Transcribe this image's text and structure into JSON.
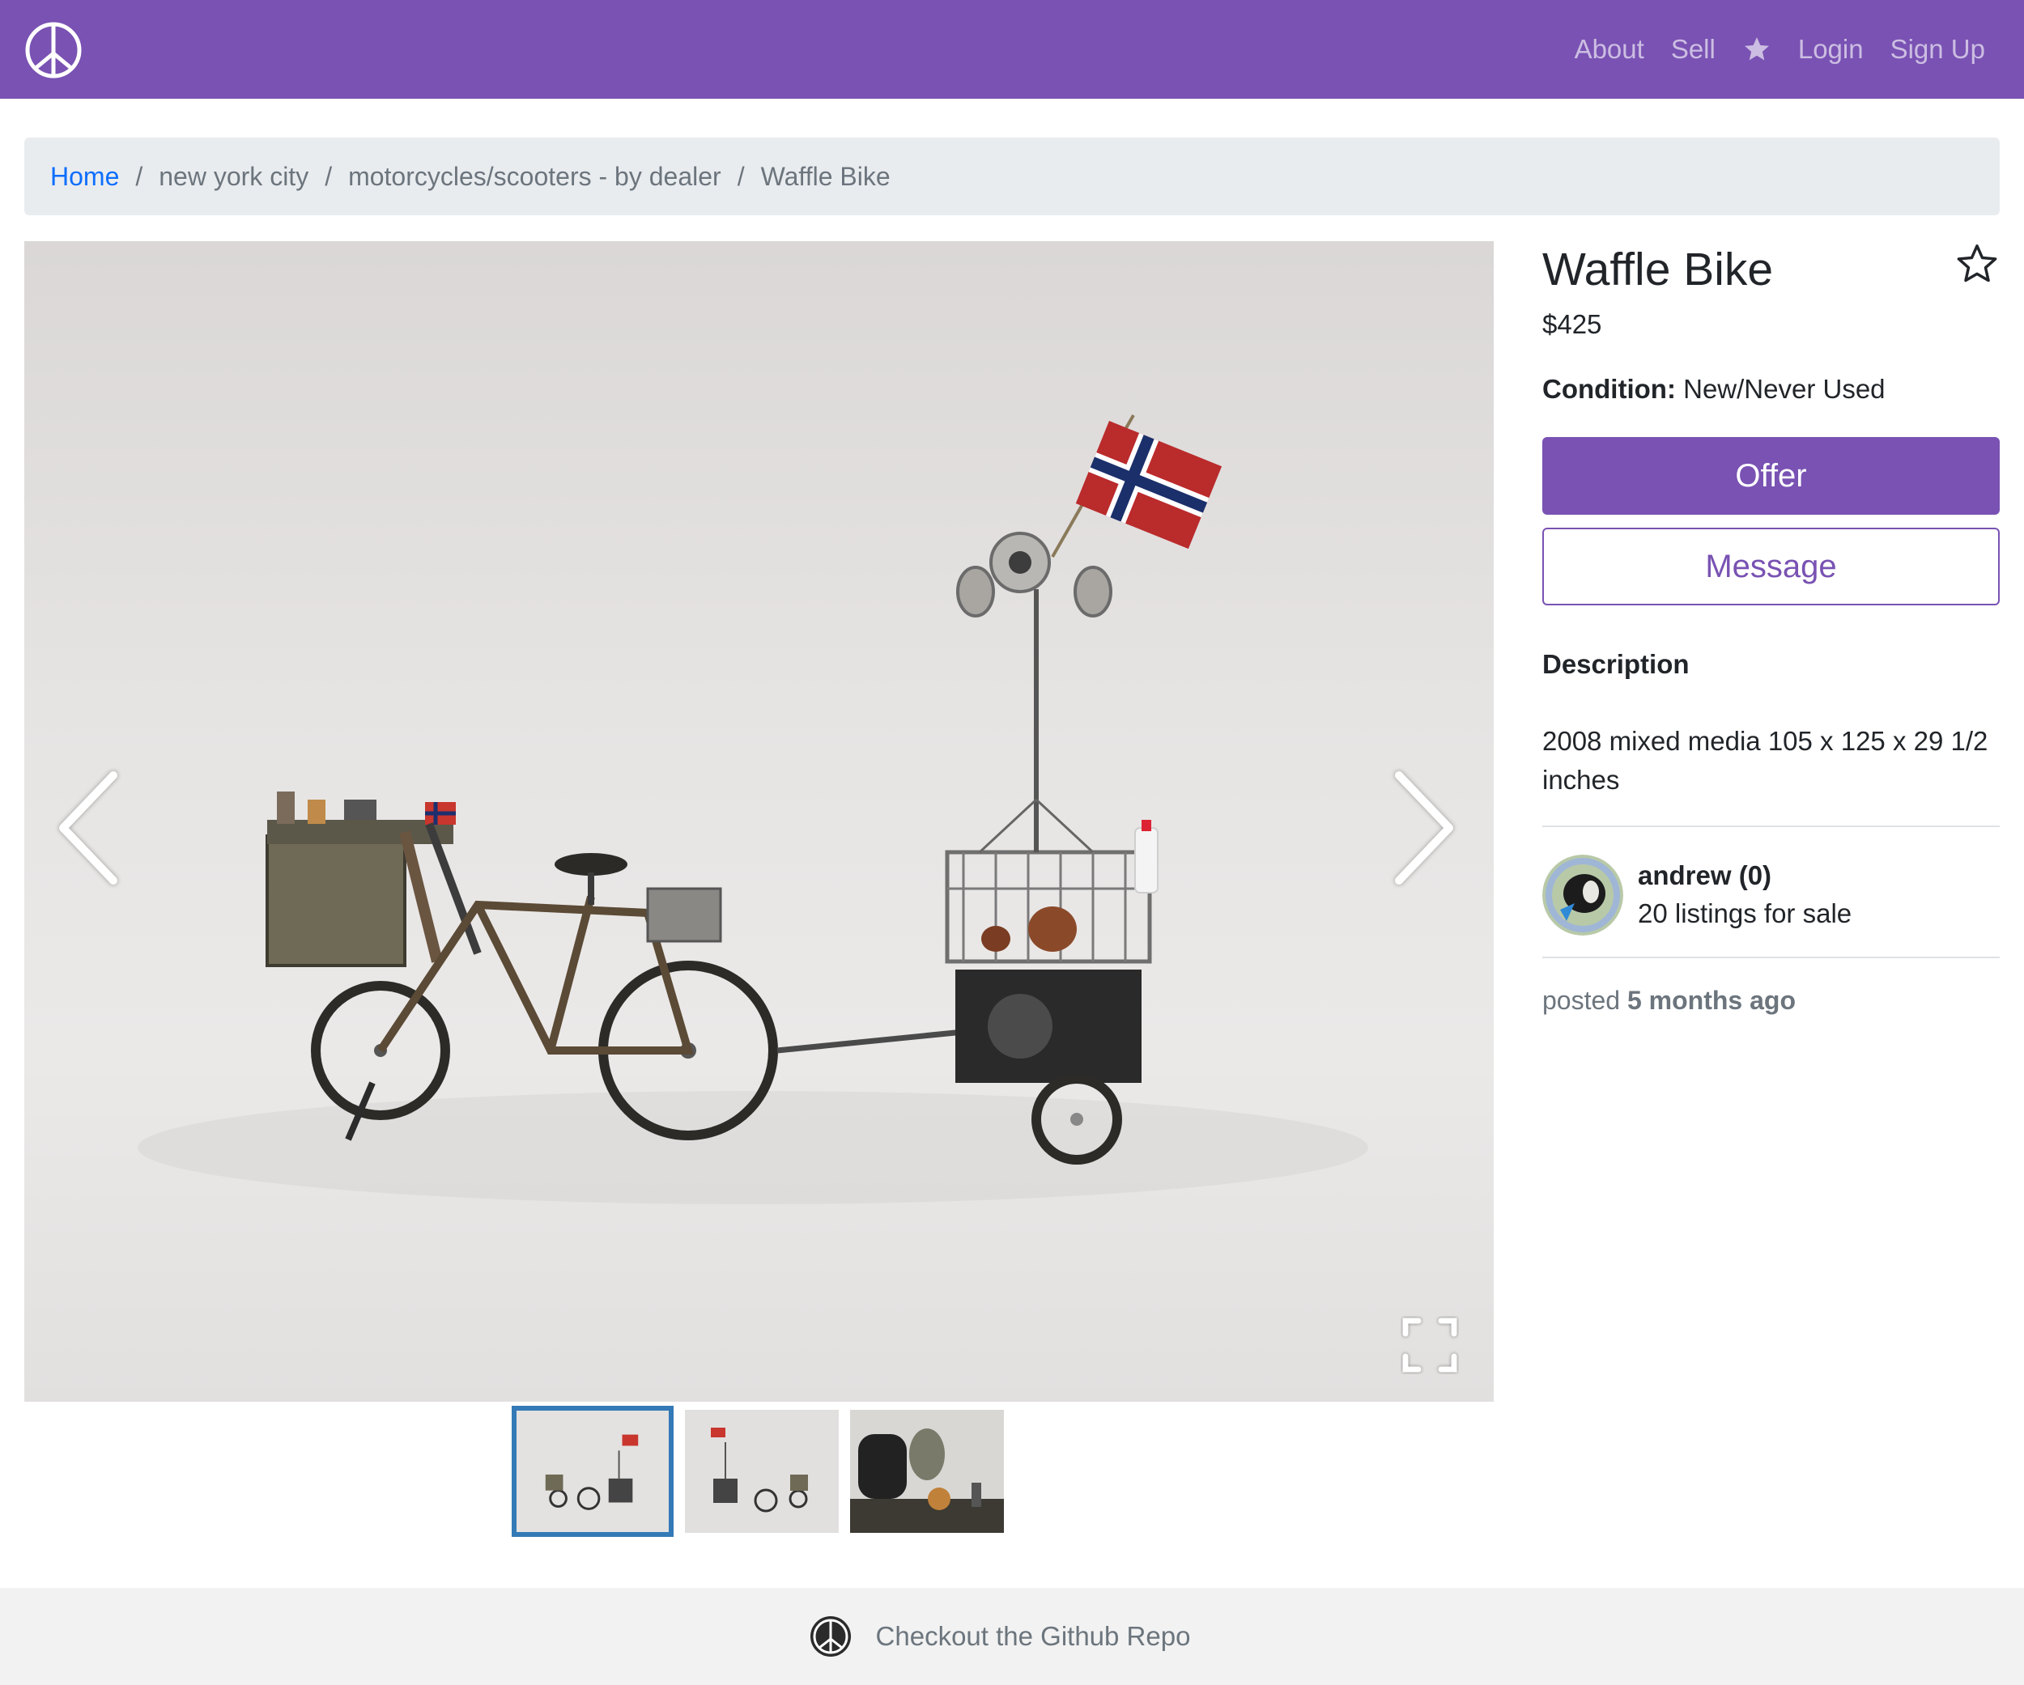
{
  "navbar": {
    "logo_icon": "peace-sign-icon",
    "links": [
      "About",
      "Sell",
      "Login",
      "Sign Up"
    ],
    "favorites_icon": "star-icon",
    "bg_color": "#7952b3"
  },
  "breadcrumb": {
    "home": "Home",
    "items": [
      "new york city",
      "motorcycles/scooters - by dealer",
      "Waffle Bike"
    ]
  },
  "gallery": {
    "prev_icon": "chevron-left-icon",
    "next_icon": "chevron-right-icon",
    "fullscreen_icon": "fullscreen-icon",
    "thumbnail_count": 3,
    "active_thumbnail": 1
  },
  "listing": {
    "title": "Waffle Bike",
    "price": "$425",
    "condition_label": "Condition:",
    "condition_value": "New/Never Used",
    "offer_label": "Offer",
    "message_label": "Message",
    "description_heading": "Description",
    "description": "2008 mixed media 105 x 125 x 29 1/2 inches",
    "favorite_icon": "star-outline-icon"
  },
  "seller": {
    "name": "andrew (0)",
    "listings": "20 listings for sale"
  },
  "posted": {
    "prefix": "posted",
    "time": "5 months ago"
  },
  "footer": {
    "logo_icon": "peace-sign-icon",
    "link": "Checkout the Github Repo"
  }
}
